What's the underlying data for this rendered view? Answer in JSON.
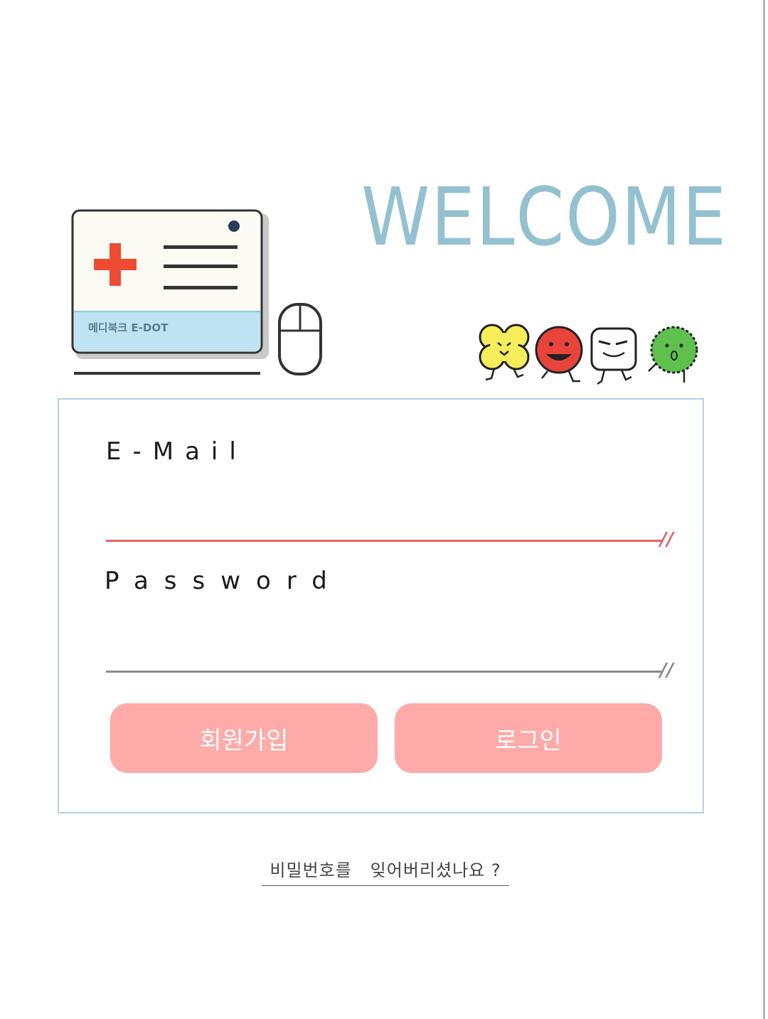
{
  "header": {
    "welcome_text": "WELCOME",
    "welcome_color": "#94c1d0",
    "monitor_screen_text": "메디북크 E-DOT"
  },
  "form": {
    "email_label": "E-Mail",
    "email_value": "",
    "password_label": "Password",
    "password_value": "",
    "email_underline_color": "#e36566",
    "password_underline_color": "#8b8b8b"
  },
  "buttons": {
    "signup_label": "회원가입",
    "login_label": "로그인",
    "button_color": "#fdaaa8"
  },
  "footer": {
    "forgot_password_label": "비밀번호를   잊어버리셨나요 ?"
  },
  "icons": {
    "medical_cross": "red-cross-icon",
    "mouse": "mouse-icon",
    "characters": [
      "yellow-flower-character",
      "red-ball-character",
      "white-square-character",
      "green-spiky-character"
    ]
  }
}
